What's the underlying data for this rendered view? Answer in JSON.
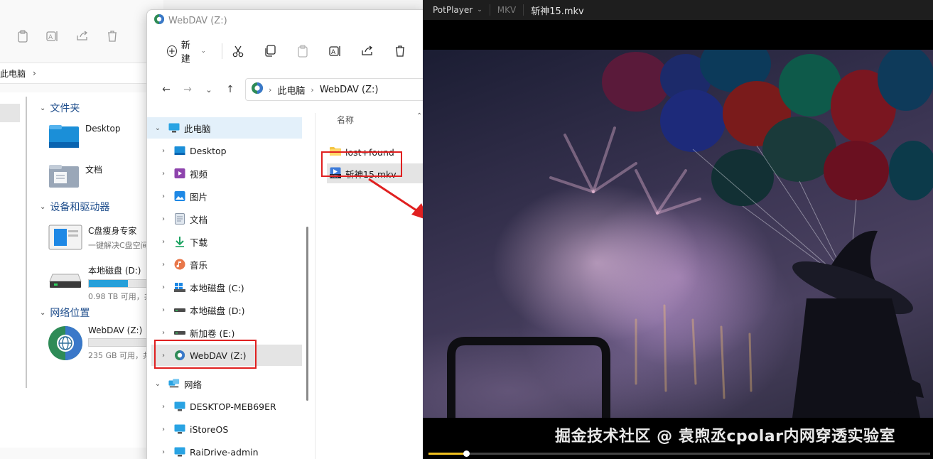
{
  "background_explorer": {
    "breadcrumb": "此电脑",
    "groups": {
      "folders": "文件夹",
      "devices": "设备和驱动器",
      "network": "网络位置"
    },
    "folders": [
      {
        "label": "Desktop",
        "icon": "desktop-folder-icon"
      },
      {
        "label": "文档",
        "icon": "documents-folder-icon"
      }
    ],
    "devices": [
      {
        "label": "C盘瘦身专家",
        "sub": "一键解决C盘空间",
        "icon": "app-icon"
      },
      {
        "label": "本地磁盘 (D:)",
        "sub": "0.98 TB 可用，共",
        "fill": 0.62,
        "icon": "hard-drive-icon"
      }
    ],
    "network": [
      {
        "label": "WebDAV (Z:)",
        "sub": "235 GB 可用，共",
        "fill": 0.0,
        "icon": "network-drive-icon"
      }
    ]
  },
  "explorer": {
    "title": "WebDAV (Z:)",
    "toolbar": {
      "new_label": "新建",
      "icons": [
        "cut-icon",
        "copy-icon",
        "paste-icon",
        "rename-icon",
        "share-icon",
        "delete-icon"
      ]
    },
    "address": {
      "path": [
        "此电脑",
        "WebDAV (Z:)"
      ]
    },
    "nav": [
      {
        "label": "此电脑",
        "icon": "computer-icon",
        "level": 0,
        "expanded": true,
        "state": "selected"
      },
      {
        "label": "Desktop",
        "icon": "desktop-icon",
        "level": 1
      },
      {
        "label": "视频",
        "icon": "video-icon",
        "level": 1
      },
      {
        "label": "图片",
        "icon": "pictures-icon",
        "level": 1
      },
      {
        "label": "文档",
        "icon": "document-icon",
        "level": 1
      },
      {
        "label": "下载",
        "icon": "download-icon",
        "level": 1
      },
      {
        "label": "音乐",
        "icon": "music-icon",
        "level": 1
      },
      {
        "label": "本地磁盘 (C:)",
        "icon": "windows-drive-icon",
        "level": 1
      },
      {
        "label": "本地磁盘 (D:)",
        "icon": "drive-icon",
        "level": 1
      },
      {
        "label": "新加卷 (E:)",
        "icon": "drive-icon",
        "level": 1
      },
      {
        "label": "WebDAV (Z:)",
        "icon": "webdav-drive-icon",
        "level": 1,
        "state": "current"
      },
      {
        "label": "网络",
        "icon": "network-icon",
        "level": 0,
        "expanded": true
      },
      {
        "label": "DESKTOP-MEB69ER",
        "icon": "monitor-icon",
        "level": 1
      },
      {
        "label": "iStoreOS",
        "icon": "monitor-icon",
        "level": 1
      },
      {
        "label": "RaiDrive-admin",
        "icon": "monitor-icon",
        "level": 1
      }
    ],
    "list": {
      "column_name": "名称",
      "files": [
        {
          "label": "lost+found",
          "icon": "folder-icon"
        },
        {
          "label": "斩神15.mkv",
          "icon": "mkv-file-icon",
          "selected": true
        }
      ]
    }
  },
  "player": {
    "app_name": "PotPlayer",
    "format": "MKV",
    "title": "斩神15.mkv",
    "subtitle": "掘金技术社区 @ 袁煦丞cpolar内网穿透实验室",
    "progress": 0.075
  },
  "colors": {
    "highlight_red": "#e02020",
    "accent_blue": "#0067c0",
    "seek_yellow": "#f0c020"
  }
}
